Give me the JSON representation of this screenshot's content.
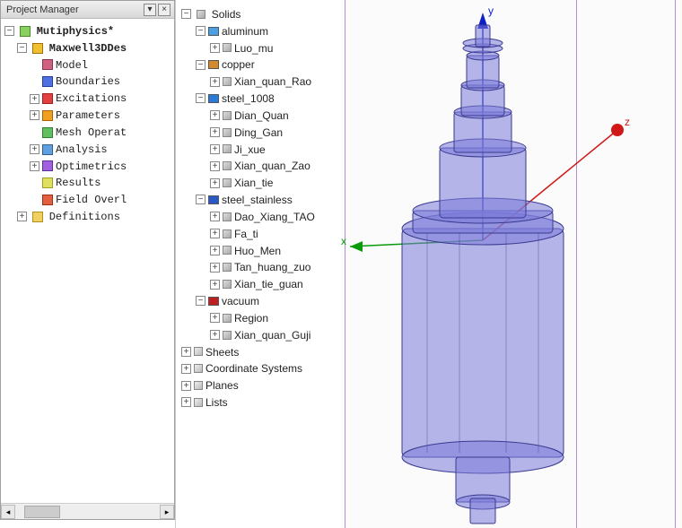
{
  "panel": {
    "title": "Project Manager",
    "pin": "▾",
    "close": "×"
  },
  "project_tree": {
    "root": "Mutiphysics*",
    "design": "Maxwell3DDes",
    "items": [
      "Model",
      "Boundaries",
      "Excitations",
      "Parameters",
      "Mesh Operat",
      "Analysis",
      "Optimetrics",
      "Results",
      "Field Overl"
    ],
    "definitions": "Definitions"
  },
  "model_tree": {
    "solids": "Solids",
    "materials": [
      {
        "name": "aluminum",
        "color": "#4aa0e8",
        "items": [
          "Luo_mu"
        ]
      },
      {
        "name": "copper",
        "color": "#d88a2a",
        "items": [
          "Xian_quan_Rao"
        ]
      },
      {
        "name": "steel_1008",
        "color": "#2a7bd8",
        "items": [
          "Dian_Quan",
          "Ding_Gan",
          "Ji_xue",
          "Xian_quan_Zao",
          "Xian_tie"
        ]
      },
      {
        "name": "steel_stainless",
        "color": "#2a58c8",
        "items": [
          "Dao_Xiang_TAO",
          "Fa_ti",
          "Huo_Men",
          "Tan_huang_zuo",
          "Xian_tie_guan"
        ]
      },
      {
        "name": "vacuum",
        "color": "#c02020",
        "items": [
          "Region",
          "Xian_quan_Guji"
        ]
      }
    ],
    "extras": [
      "Sheets",
      "Coordinate Systems",
      "Planes",
      "Lists"
    ]
  },
  "axes": {
    "x": "x",
    "y": "y",
    "z": "z"
  },
  "toggle": {
    "plus": "+",
    "minus": "−"
  }
}
